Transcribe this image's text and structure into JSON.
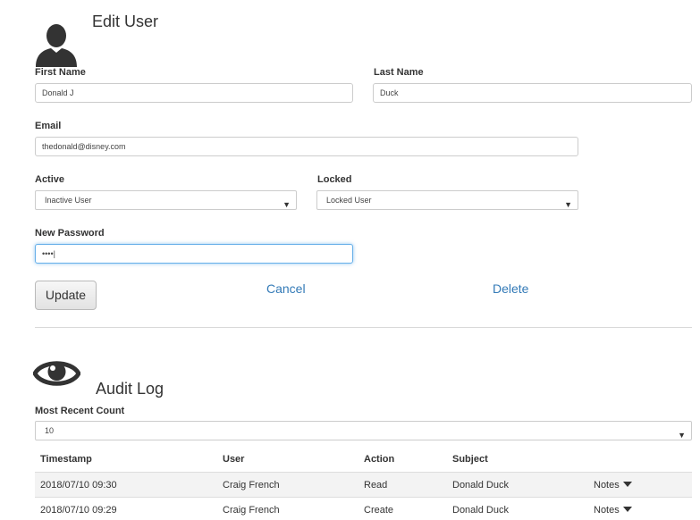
{
  "edit_user": {
    "title": "Edit User",
    "first_name_label": "First Name",
    "first_name_value": "Donald J",
    "last_name_label": "Last Name",
    "last_name_value": "Duck",
    "email_label": "Email",
    "email_value": "thedonald@disney.com",
    "active_label": "Active",
    "active_value": "Inactive User",
    "locked_label": "Locked",
    "locked_value": "Locked User",
    "new_password_label": "New Password",
    "new_password_value": "••••|",
    "update_label": "Update",
    "cancel_label": "Cancel",
    "delete_label": "Delete"
  },
  "audit_log": {
    "title": "Audit Log",
    "count_label": "Most Recent Count",
    "count_value": "10",
    "columns": [
      "Timestamp",
      "User",
      "Action",
      "Subject"
    ],
    "rows": [
      {
        "timestamp": "2018/07/10 09:30",
        "user": "Craig French",
        "action": "Read",
        "subject": "Donald Duck",
        "notes": "Notes"
      },
      {
        "timestamp": "2018/07/10 09:29",
        "user": "Craig French",
        "action": "Create",
        "subject": "Donald Duck",
        "notes": "Notes"
      }
    ]
  },
  "icons": {
    "user": "user-silhouette-icon",
    "eye": "eye-icon",
    "dropdown": "caret-down-icon"
  },
  "colors": {
    "link": "#337ab7",
    "focus_border": "#66afe9",
    "icon": "#333333",
    "row_stripe": "#f3f3f3"
  }
}
